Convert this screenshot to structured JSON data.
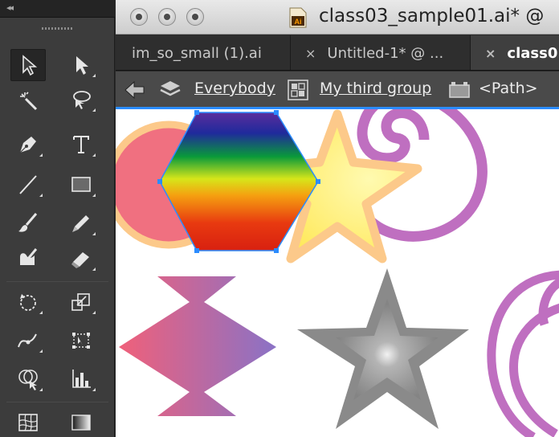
{
  "window": {
    "title": "class03_sample01.ai* @",
    "icon": "illustrator-document-icon"
  },
  "tabs": [
    {
      "label": "im_so_small (1).ai",
      "close": "",
      "active": false
    },
    {
      "label": "Untitled-1* @ ...",
      "close": "×",
      "active": false
    },
    {
      "label": "class0",
      "close": "×",
      "active": true
    }
  ],
  "breadcrumb": {
    "items": [
      {
        "label": "Everybody",
        "icon": "layer-icon"
      },
      {
        "label": "My third group",
        "icon": "group-icon"
      },
      {
        "label": "<Path>",
        "icon": "path-icon"
      }
    ]
  },
  "tools_panel": {
    "collapse_glyph": "◂◂",
    "tools": [
      "selection-tool",
      "direct-selection-tool",
      "magic-wand-tool",
      "lasso-tool",
      "pen-tool",
      "type-tool",
      "line-segment-tool",
      "rectangle-tool",
      "paintbrush-tool",
      "pencil-tool",
      "blob-brush-tool",
      "eraser-tool",
      "rotate-tool",
      "scale-tool",
      "width-tool",
      "free-transform-tool",
      "shape-builder-tool",
      "graph-tool",
      "mesh-tool",
      "gradient-tool"
    ],
    "active_tool": "selection-tool"
  },
  "colors": {
    "panel_bg": "#3c3c3c",
    "selection_blue": "#2b8cff",
    "circle_fill": "#f07080",
    "circle_stroke": "#fcc98a",
    "star_fill": "#fff27a",
    "star_stroke": "#fcc98a",
    "spiral": "#bf6fc0",
    "gray_star": "#8a8a8a"
  }
}
